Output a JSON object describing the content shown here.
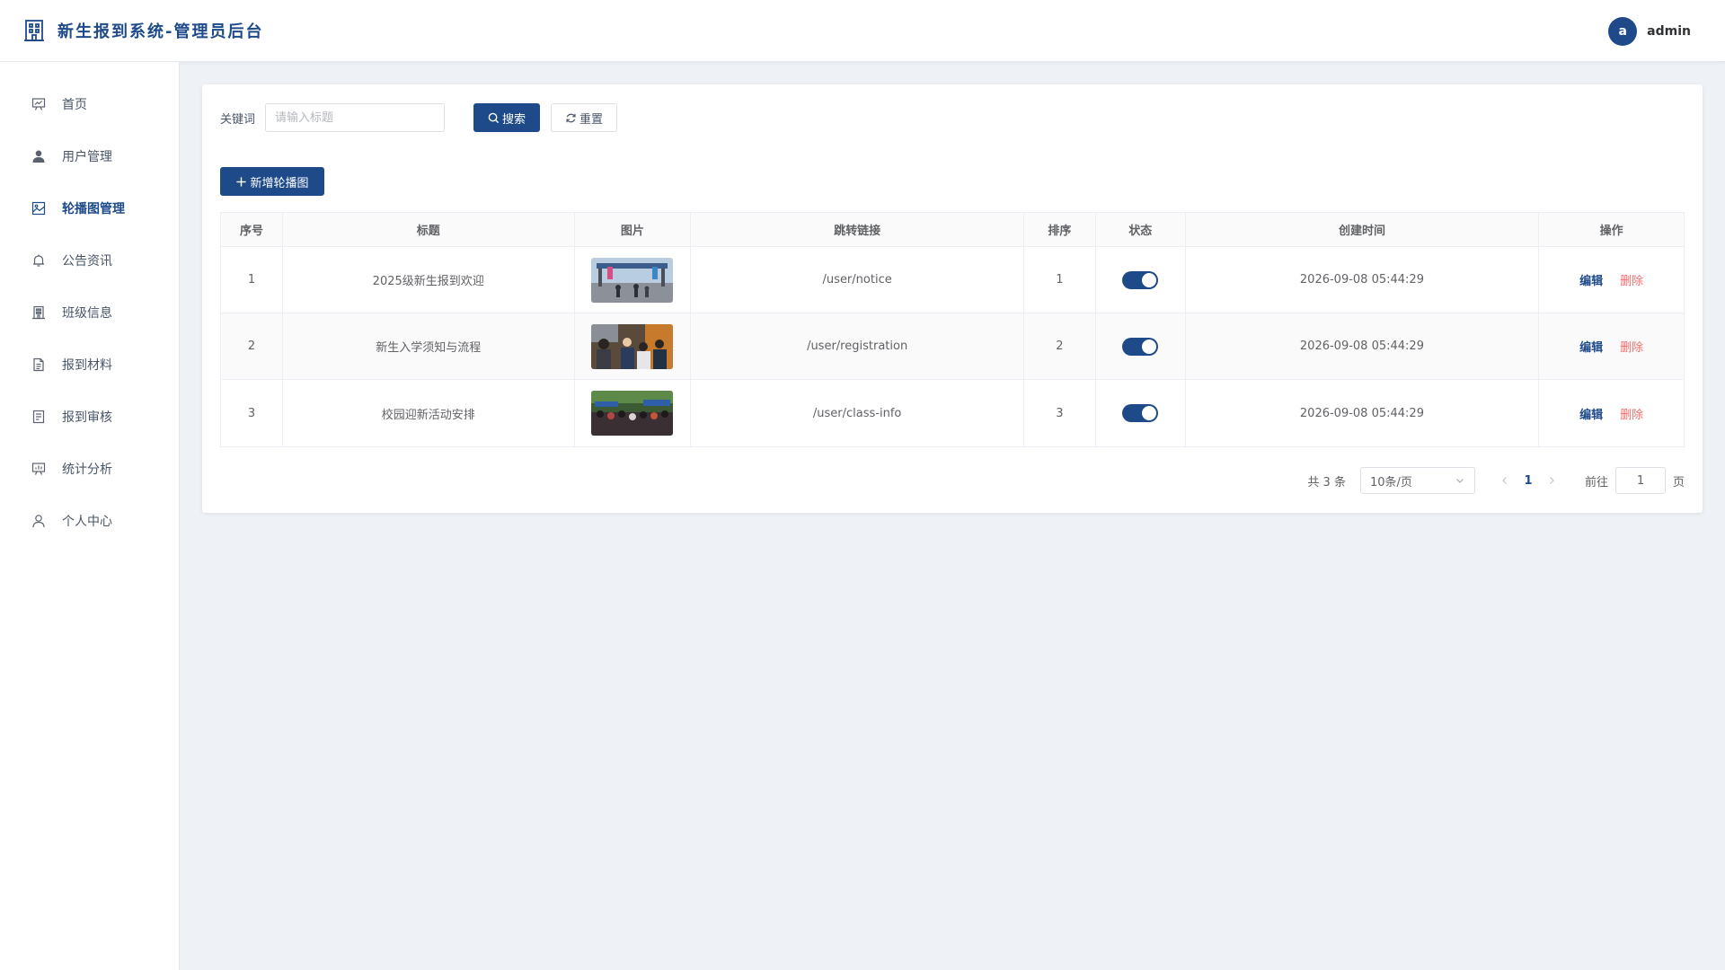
{
  "header": {
    "title": "新生报到系统-管理员后台",
    "avatar_letter": "a",
    "username": "admin"
  },
  "sidebar": {
    "items": [
      {
        "label": "首页",
        "icon": "presentation-icon",
        "active": false
      },
      {
        "label": "用户管理",
        "icon": "user-filled-icon",
        "active": false
      },
      {
        "label": "轮播图管理",
        "icon": "picture-icon",
        "active": true
      },
      {
        "label": "公告资讯",
        "icon": "bell-icon",
        "active": false
      },
      {
        "label": "班级信息",
        "icon": "building-icon",
        "active": false
      },
      {
        "label": "报到材料",
        "icon": "document-icon",
        "active": false
      },
      {
        "label": "报到审核",
        "icon": "tickets-icon",
        "active": false
      },
      {
        "label": "统计分析",
        "icon": "data-board-icon",
        "active": false
      },
      {
        "label": "个人中心",
        "icon": "user-icon",
        "active": false
      }
    ]
  },
  "filter": {
    "keyword_label": "关键词",
    "keyword_placeholder": "请输入标题",
    "keyword_value": "",
    "search_label": "搜索",
    "reset_label": "重置"
  },
  "toolbar": {
    "add_label": "新增轮播图"
  },
  "table": {
    "columns": [
      "序号",
      "标题",
      "图片",
      "跳转链接",
      "排序",
      "状态",
      "创建时间",
      "操作"
    ],
    "rows": [
      {
        "index": "1",
        "title": "2025级新生报到欢迎",
        "link": "/user/notice",
        "sort": "1",
        "enabled": true,
        "created": "2026-09-08 05:44:29",
        "edit": "编辑",
        "delete": "删除"
      },
      {
        "index": "2",
        "title": "新生入学须知与流程",
        "link": "/user/registration",
        "sort": "2",
        "enabled": true,
        "created": "2026-09-08 05:44:29",
        "edit": "编辑",
        "delete": "删除"
      },
      {
        "index": "3",
        "title": "校园迎新活动安排",
        "link": "/user/class-info",
        "sort": "3",
        "enabled": true,
        "created": "2026-09-08 05:44:29",
        "edit": "编辑",
        "delete": "删除"
      }
    ]
  },
  "pagination": {
    "total_text": "共 3 条",
    "page_size": "10条/页",
    "current_page": "1",
    "goto_label": "前往",
    "goto_value": "1",
    "page_suffix": "页"
  },
  "colors": {
    "primary": "#1e4a8a",
    "danger": "#f56c6c",
    "background": "#eef1f5"
  }
}
